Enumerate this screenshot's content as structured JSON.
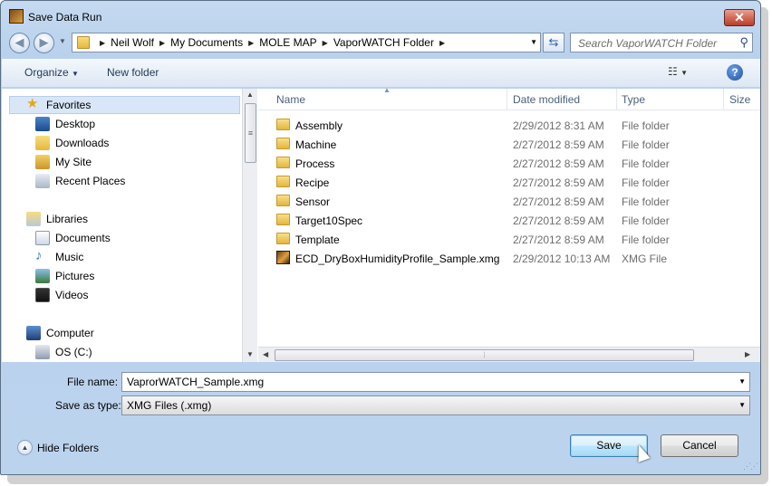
{
  "window": {
    "title": "Save Data Run",
    "close_label": "✕"
  },
  "address": {
    "crumbs": [
      "Neil Wolf",
      "My Documents",
      "MOLE MAP",
      "VaporWATCH Folder"
    ]
  },
  "search": {
    "placeholder": "Search VaporWATCH Folder"
  },
  "toolbar": {
    "organize_label": "Organize",
    "new_folder_label": "New folder"
  },
  "nav": {
    "favorites_label": "Favorites",
    "favorites": [
      "Desktop",
      "Downloads",
      "My Site",
      "Recent Places"
    ],
    "libraries_label": "Libraries",
    "libraries": [
      "Documents",
      "Music",
      "Pictures",
      "Videos"
    ],
    "computer_label": "Computer",
    "computer": [
      "OS (C:)"
    ]
  },
  "columns": {
    "name": "Name",
    "date": "Date modified",
    "type": "Type",
    "size": "Size"
  },
  "files": [
    {
      "name": "Assembly",
      "date": "2/29/2012 8:31 AM",
      "type": "File folder",
      "icon": "folder-icon"
    },
    {
      "name": "Machine",
      "date": "2/27/2012 8:59 AM",
      "type": "File folder",
      "icon": "folder-icon"
    },
    {
      "name": "Process",
      "date": "2/27/2012 8:59 AM",
      "type": "File folder",
      "icon": "folder-icon"
    },
    {
      "name": "Recipe",
      "date": "2/27/2012 8:59 AM",
      "type": "File folder",
      "icon": "folder-icon"
    },
    {
      "name": "Sensor",
      "date": "2/27/2012 8:59 AM",
      "type": "File folder",
      "icon": "folder-icon"
    },
    {
      "name": "Target10Spec",
      "date": "2/27/2012 8:59 AM",
      "type": "File folder",
      "icon": "folder-icon"
    },
    {
      "name": "Template",
      "date": "2/27/2012 8:59 AM",
      "type": "File folder",
      "icon": "folder-icon"
    },
    {
      "name": "ECD_DryBoxHumidityProfile_Sample.xmg",
      "date": "2/29/2012 10:13 AM",
      "type": "XMG File",
      "icon": "xmg-file-icon"
    }
  ],
  "form": {
    "file_name_label": "File name:",
    "file_name_value": "VaprorWATCH_Sample.xmg",
    "save_type_label": "Save as type:",
    "save_type_value": "XMG Files (.xmg)"
  },
  "footer": {
    "hide_folders_label": "Hide Folders",
    "save_label": "Save",
    "cancel_label": "Cancel"
  },
  "colors": {
    "close_red": "#c7503d",
    "selection": "#d8e6f7",
    "window_frame": "#b9d1ec"
  }
}
